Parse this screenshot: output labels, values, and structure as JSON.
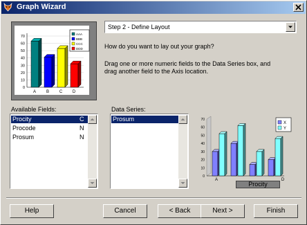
{
  "window": {
    "title": "Graph Wizard"
  },
  "step": {
    "selected": "Step 2 - Define Layout"
  },
  "instructions": {
    "question": "How do you want to lay out your graph?",
    "line1": "Drag one or more numeric fields to the Data Series box, and",
    "line2": "drag another field to the Axis location."
  },
  "available_fields": {
    "label": "Available Fields:",
    "items": [
      {
        "name": "Procity",
        "type": "C",
        "selected": true
      },
      {
        "name": "Procode",
        "type": "N",
        "selected": false
      },
      {
        "name": "Prosum",
        "type": "N",
        "selected": false
      }
    ]
  },
  "data_series": {
    "label": "Data Series:",
    "items": [
      {
        "name": "Prosum",
        "selected": true
      }
    ]
  },
  "axis_field": {
    "label": "Procity"
  },
  "preview_chart": {
    "categories": [
      "A",
      "B",
      "C",
      "D"
    ],
    "yticks": [
      "70",
      "60",
      "50",
      "40",
      "30",
      "20",
      "10",
      "0"
    ],
    "legend": [
      "AAA",
      "BBB",
      "CCC",
      "DDD"
    ],
    "colors": [
      "#008080",
      "#0000ff",
      "#ffff00",
      "#ff0000"
    ]
  },
  "layout_chart": {
    "yticks": [
      "70",
      "60",
      "50",
      "40",
      "30",
      "20",
      "10",
      "0"
    ],
    "x_labels": [
      "A",
      "D"
    ],
    "legend": [
      "X",
      "Y"
    ],
    "colors": {
      "x": "#8080ff",
      "y": "#80ffff"
    }
  },
  "chart_data": {
    "type": "bar",
    "categories": [
      "A",
      "B",
      "C",
      "D"
    ],
    "values": [
      63,
      41,
      53,
      32
    ],
    "ylim": [
      0,
      70
    ]
  },
  "buttons": {
    "help": "Help",
    "cancel": "Cancel",
    "back": "< Back",
    "next": "Next >",
    "finish": "Finish"
  }
}
